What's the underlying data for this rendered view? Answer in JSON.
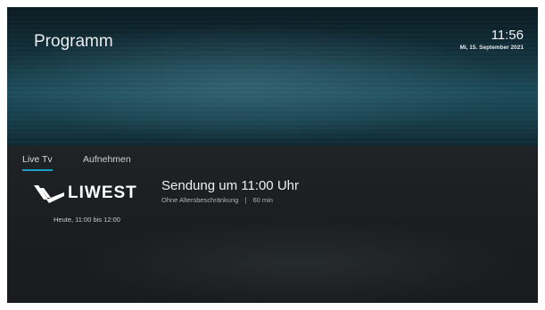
{
  "header": {
    "title": "Programm",
    "time": "11:56",
    "date": "Mi, 15. September 2021"
  },
  "tabs": [
    {
      "label": "Live Tv",
      "active": true
    },
    {
      "label": "Aufnehmen",
      "active": false
    }
  ],
  "program": {
    "channel_logo_text": "LIWEST",
    "title": "Sendung um 11:00 Uhr",
    "age_rating": "Ohne Altersbeschränkung",
    "separator": "|",
    "duration": "60 min",
    "time_range": "Heute, 11:00 bis 12:00"
  },
  "colors": {
    "accent": "#1aa0c8",
    "background": "#1b1e21",
    "text": "#eef1f3"
  }
}
